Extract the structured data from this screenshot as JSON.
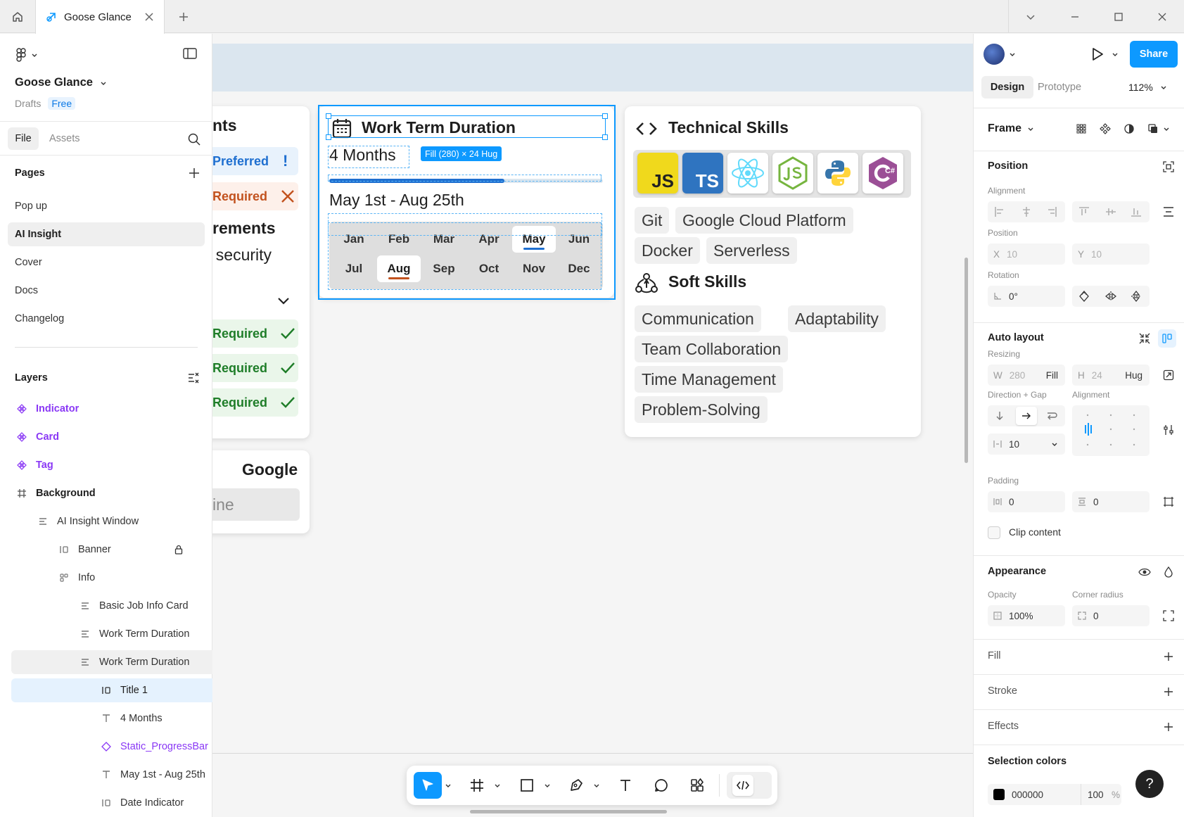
{
  "window": {
    "tab_title": "Goose Glance"
  },
  "left_panel": {
    "project_name": "Goose Glance",
    "drafts_label": "Drafts",
    "plan_badge": "Free",
    "tabs": [
      "File",
      "Assets"
    ],
    "pages_heading": "Pages",
    "pages": [
      "Pop up",
      "AI Insight",
      "Cover",
      "Docs",
      "Changelog"
    ],
    "layers_heading": "Layers",
    "layers": [
      {
        "name": "Indicator",
        "kind": "component"
      },
      {
        "name": "Card",
        "kind": "component"
      },
      {
        "name": "Tag",
        "kind": "component"
      },
      {
        "name": "Background",
        "kind": "frame"
      },
      {
        "name": "AI Insight Window",
        "kind": "autolayout-v"
      },
      {
        "name": "Banner",
        "kind": "autolayout-h",
        "locked": true
      },
      {
        "name": "Info",
        "kind": "grid"
      },
      {
        "name": "Basic Job Info Card",
        "kind": "autolayout-v"
      },
      {
        "name": "Work Term Duration",
        "kind": "autolayout-v"
      },
      {
        "name": "Work Term Duration",
        "kind": "autolayout-v"
      },
      {
        "name": "Title 1",
        "kind": "autolayout-h"
      },
      {
        "name": "4 Months",
        "kind": "text"
      },
      {
        "name": "Static_ProgressBar",
        "kind": "instance"
      },
      {
        "name": "May 1st - Aug 25th",
        "kind": "text"
      },
      {
        "name": "Date Indicator",
        "kind": "autolayout-h"
      }
    ]
  },
  "canvas": {
    "left_card": {
      "partial_title": "nts",
      "preferred_label": "Preferred",
      "preferred_mark": "!",
      "required_label": "Required",
      "partial_heading": "rements",
      "partial_text": "f security",
      "required_rows": [
        "Required",
        "Required",
        "Required"
      ]
    },
    "google_card": {
      "title": "Google",
      "partial_input": "ine"
    },
    "work_term": {
      "title": "Work Term Duration",
      "duration": "4 Months",
      "selection_badge": "Fill (280) × 24 Hug",
      "progress": 0.64,
      "date_range": "May 1st - Aug 25th",
      "months_row1": [
        "Jan",
        "Feb",
        "Mar",
        "Apr",
        "May",
        "Jun"
      ],
      "months_row2": [
        "Jul",
        "Aug",
        "Sep",
        "Oct",
        "Nov",
        "Dec"
      ],
      "active_months": [
        "May",
        "Aug"
      ],
      "start_color": "#1e6fd0",
      "end_color": "#c2521e"
    },
    "technical_skills": {
      "title": "Technical Skills",
      "icons": [
        "javascript-icon",
        "typescript-icon",
        "react-icon",
        "nodejs-icon",
        "python-icon",
        "csharp-icon"
      ],
      "icon_texts": {
        "js": "JS",
        "ts": "TS",
        "cs": "C#"
      },
      "tags": [
        "Git",
        "Google Cloud Platform",
        "Docker",
        "Serverless"
      ]
    },
    "soft_skills": {
      "title": "Soft Skills",
      "tags": [
        "Communication",
        "Adaptability",
        "Team Collaboration",
        "Time Management",
        "Problem-Solving"
      ]
    }
  },
  "right_panel": {
    "share_label": "Share",
    "tabs": [
      "Design",
      "Prototype"
    ],
    "zoom": "112%",
    "frame_label": "Frame",
    "position_heading": "Position",
    "alignment_label": "Alignment",
    "position_label": "Position",
    "x_prefix": "X",
    "x_value": "10",
    "y_prefix": "Y",
    "y_value": "10",
    "rotation_label": "Rotation",
    "rotation_value": "0°",
    "auto_layout_heading": "Auto layout",
    "resizing_label": "Resizing",
    "w_prefix": "W",
    "w_value": "280",
    "w_mode": "Fill",
    "h_prefix": "H",
    "h_value": "24",
    "h_mode": "Hug",
    "direction_gap_label": "Direction + Gap",
    "alignment2_label": "Alignment",
    "gap_value": "10",
    "padding_label": "Padding",
    "padding_h": "0",
    "padding_v": "0",
    "clip_content_label": "Clip content",
    "appearance_heading": "Appearance",
    "opacity_label": "Opacity",
    "opacity_value": "100%",
    "corner_radius_label": "Corner radius",
    "corner_radius_value": "0",
    "fill_heading": "Fill",
    "stroke_heading": "Stroke",
    "effects_heading": "Effects",
    "selection_colors_heading": "Selection colors",
    "selection_color_hex": "000000",
    "selection_color_opacity": "100",
    "percent_sign": "%",
    "help_label": "?",
    "accent_color": "#0d99ff"
  }
}
